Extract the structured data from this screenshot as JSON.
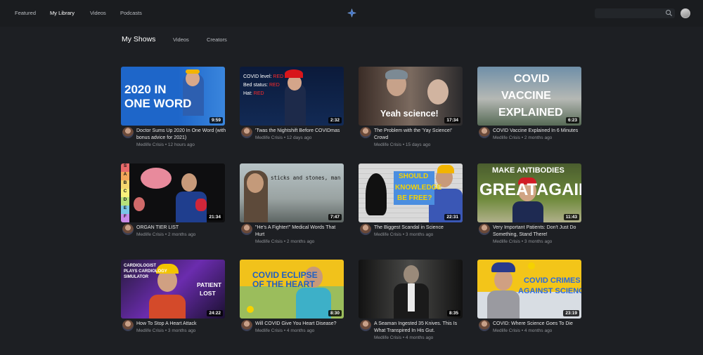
{
  "nav": {
    "items": [
      "Featured",
      "My Library",
      "Videos",
      "Podcasts"
    ],
    "active": "My Library"
  },
  "icons": {
    "logo": "star-icon",
    "search": "search-icon",
    "profile": "avatar"
  },
  "subnav": {
    "items": [
      "My Shows",
      "Videos",
      "Creators"
    ],
    "active": "My Shows"
  },
  "videos": [
    {
      "title": "Doctor Sums Up 2020 In One Word (with bonus advice for 2021)",
      "channel": "Medlife Crisis",
      "age": "12 hours ago",
      "duration": "9:59",
      "thumb_text": [
        "2020 IN",
        "ONE WORD"
      ]
    },
    {
      "title": "'Twas the Nightshift Before COVIDmas",
      "channel": "Medlife Crisis",
      "age": "12 days ago",
      "duration": "2:32",
      "thumb_text": [
        "COVID level:",
        "Bed status:",
        "Hat:",
        "RED"
      ]
    },
    {
      "title": "The Problem with the 'Yay Science!' Crowd",
      "channel": "Medlife Crisis",
      "age": "15 days ago",
      "duration": "17:34",
      "thumb_text": [
        "Yeah science!"
      ]
    },
    {
      "title": "COVID Vaccine Explained In 6 Minutes",
      "channel": "Medlife Crisis",
      "age": "2 months ago",
      "duration": "6:23",
      "thumb_text": [
        "COVID",
        "VACCINE",
        "EXPLAINED"
      ]
    },
    {
      "title": "ORGAN TIER LIST",
      "channel": "Medlife Crisis",
      "age": "2 months ago",
      "duration": "21:34",
      "thumb_text": [
        "S",
        "A",
        "B",
        "C",
        "D",
        "E",
        "F"
      ]
    },
    {
      "title": "\"He's A Fighter!\" Medical Words That Hurt",
      "channel": "Medlife Crisis",
      "age": "2 months ago",
      "duration": "7:47",
      "thumb_text": [
        "sticks and stones, man"
      ]
    },
    {
      "title": "The Biggest Scandal in Science",
      "channel": "Medlife Crisis",
      "age": "3 months ago",
      "duration": "22:31",
      "thumb_text": [
        "SHOULD",
        "KNOWLEDGE",
        "BE FREE?"
      ]
    },
    {
      "title": "Very Important Patients: Don't Just Do Something, Stand There!",
      "channel": "Medlife Crisis",
      "age": "3 months ago",
      "duration": "11:43",
      "thumb_text": [
        "MAKE ANTIBODIES",
        "GREAT",
        "AGAIN"
      ]
    },
    {
      "title": "How To Stop A Heart Attack",
      "channel": "Medlife Crisis",
      "age": "3 months ago",
      "duration": "24:22",
      "thumb_text": [
        "CARDIOLOGIST",
        "PLAYS CARDIOLOGY",
        "SIMULATOR",
        "PATIENT",
        "LOST"
      ]
    },
    {
      "title": "Will COVID Give You Heart Disease?",
      "channel": "Medlife Crisis",
      "age": "4 months ago",
      "duration": "8:30",
      "thumb_text": [
        "COVID ECLIPSE",
        "OF THE HEART"
      ]
    },
    {
      "title": "A Seaman Ingested 35 Knives. This Is What Transpired In His Gut.",
      "channel": "Medlife Crisis",
      "age": "4 months ago",
      "duration": "8:35",
      "thumb_text": []
    },
    {
      "title": "COVID: Where Science Goes To Die",
      "channel": "Medlife Crisis",
      "age": "4 months ago",
      "duration": "23:19",
      "thumb_text": [
        "COVID CRIMES",
        "AGAINST SCIENCE"
      ]
    }
  ]
}
